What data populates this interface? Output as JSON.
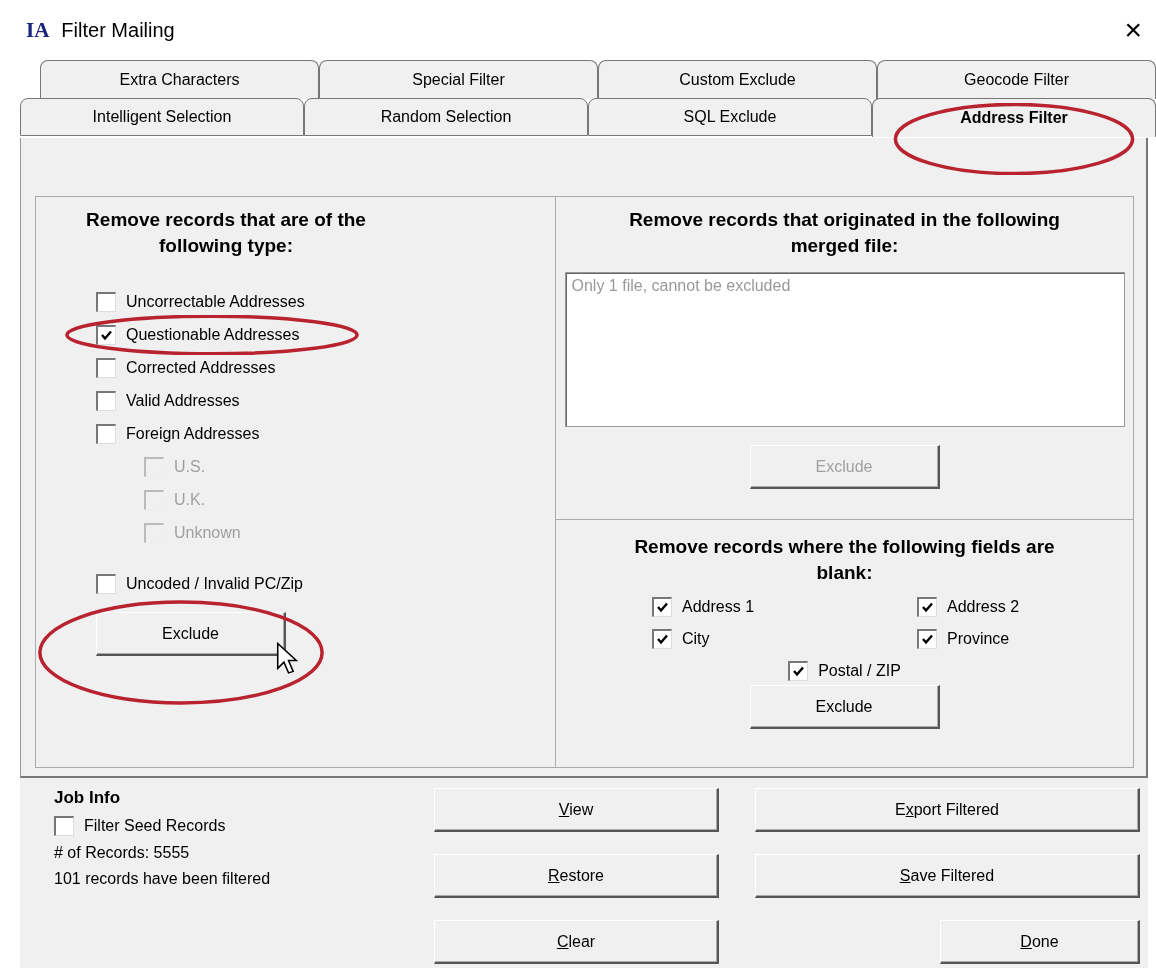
{
  "window": {
    "logo": "IA",
    "title": "Filter Mailing",
    "close": "×"
  },
  "tab_rows": [
    [
      {
        "label": "Extra Characters",
        "selected": false
      },
      {
        "label": "Special Filter",
        "selected": false
      },
      {
        "label": "Custom Exclude",
        "selected": false
      },
      {
        "label": "Geocode Filter",
        "selected": false
      }
    ],
    [
      {
        "label": "Intelligent Selection",
        "selected": false
      },
      {
        "label": "Random Selection",
        "selected": false
      },
      {
        "label": "SQL Exclude",
        "selected": false
      },
      {
        "label": "Address Filter",
        "selected": true
      }
    ]
  ],
  "type_filter": {
    "heading": "Remove records that are of the following type:",
    "options": [
      {
        "label": "Uncorrectable Addresses",
        "checked": false,
        "disabled": false
      },
      {
        "label": "Questionable Addresses",
        "checked": true,
        "disabled": false
      },
      {
        "label": "Corrected Addresses",
        "checked": false,
        "disabled": false
      },
      {
        "label": "Valid Addresses",
        "checked": false,
        "disabled": false
      },
      {
        "label": "Foreign Addresses",
        "checked": false,
        "disabled": false,
        "children": [
          {
            "label": "U.S.",
            "checked": false,
            "disabled": true
          },
          {
            "label": "U.K.",
            "checked": false,
            "disabled": true
          },
          {
            "label": "Unknown",
            "checked": false,
            "disabled": true
          }
        ]
      },
      {
        "label": "Uncoded / Invalid PC/Zip",
        "checked": false,
        "disabled": false
      }
    ],
    "button": {
      "label": "Exclude",
      "disabled": false
    }
  },
  "merged_filter": {
    "heading": "Remove records that originated in the following merged file:",
    "list_items": [
      {
        "label": "Only 1 file, cannot be excluded",
        "disabled": true
      }
    ],
    "button": {
      "label": "Exclude",
      "disabled": true
    }
  },
  "blank_filter": {
    "heading": "Remove records where the following fields are blank:",
    "fields": [
      {
        "label": "Address 1",
        "checked": true
      },
      {
        "label": "Address 2",
        "checked": true
      },
      {
        "label": "City",
        "checked": true
      },
      {
        "label": "Province",
        "checked": true
      },
      {
        "label": "Postal / ZIP",
        "checked": true
      }
    ],
    "button": {
      "label": "Exclude",
      "disabled": false
    }
  },
  "job_info": {
    "title": "Job Info",
    "seed": {
      "label": "Filter Seed Records",
      "checked": false
    },
    "records": "# of Records: 5555",
    "filtered": "101 records have been filtered"
  },
  "buttons": [
    {
      "key": "V",
      "after": "iew"
    },
    {
      "before": "E",
      "key": "x",
      "after": "port Filtered"
    },
    {
      "key": "R",
      "after": "estore"
    },
    {
      "key": "S",
      "after": "ave Filtered"
    },
    {
      "key": "C",
      "after": "lear"
    },
    {
      "key": "D",
      "after": "one"
    }
  ]
}
